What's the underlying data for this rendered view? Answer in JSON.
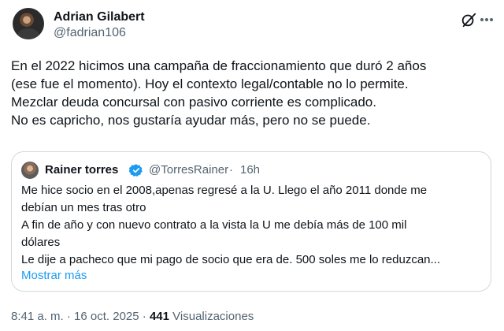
{
  "tweet": {
    "author_name": "Adrian Gilabert",
    "author_handle": "@fadrian106",
    "text": "En el 2022 hicimos  una campaña de fraccionamiento que duró 2 años\n(ese fue el momento). Hoy el contexto legal/contable no lo permite.\nMezclar deuda concursal con pasivo corriente es complicado.\nNo es capricho, nos gustaría ayudar más, pero no se puede.",
    "time": "8:41 a. m.",
    "date": "16 oct. 2025",
    "separator": "·",
    "views_count": "441",
    "views_label": "Visualizaciones"
  },
  "quote": {
    "author_name": "Rainer torres",
    "author_handle": "@TorresRainer",
    "separator": "·",
    "time": "16h",
    "text": "Me hice socio en el 2008,apenas regresé a la U. Llego el año 2011 donde me\ndebían un mes tras otro\nA fin de año y con nuevo contrato a la vista la U me debía más de 100 mil\ndólares\nLe dije a pacheco que mi pago de socio que era de. 500 soles me lo reduzcan...",
    "show_more": "Mostrar más"
  },
  "icons": {
    "grok": "grok-icon",
    "more": "more-options-icon",
    "verified": "verified-badge-icon"
  },
  "colors": {
    "link": "#1d9bf0",
    "secondary_text": "#536471",
    "border": "#cfd9de"
  }
}
